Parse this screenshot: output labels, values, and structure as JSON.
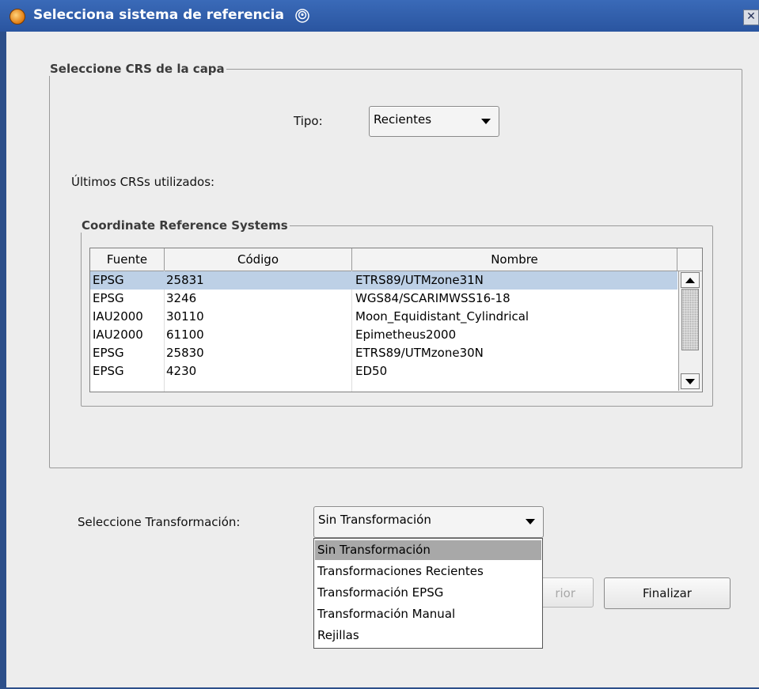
{
  "window": {
    "title": "Selecciona sistema de referencia",
    "close_glyph": "✕",
    "accent_color": "#3a6ab8"
  },
  "crs_group": {
    "legend": "Seleccione CRS de la capa",
    "tipo_label": "Tipo:",
    "tipo_value": "Recientes",
    "recent_label": "Últimos CRSs utilizados:"
  },
  "crs_table": {
    "legend": "Coordinate Reference Systems",
    "columns": [
      "Fuente",
      "Código",
      "Nombre"
    ],
    "rows": [
      {
        "fuente": "EPSG",
        "codigo": "25831",
        "nombre": "ETRS89/UTMzone31N",
        "selected": true
      },
      {
        "fuente": "EPSG",
        "codigo": "3246",
        "nombre": "WGS84/SCARIMWSS16-18",
        "selected": false
      },
      {
        "fuente": "IAU2000",
        "codigo": "30110",
        "nombre": "Moon_Equidistant_Cylindrical",
        "selected": false
      },
      {
        "fuente": "IAU2000",
        "codigo": "61100",
        "nombre": "Epimetheus2000",
        "selected": false
      },
      {
        "fuente": "EPSG",
        "codigo": "25830",
        "nombre": "ETRS89/UTMzone30N",
        "selected": false
      },
      {
        "fuente": "EPSG",
        "codigo": "4230",
        "nombre": "ED50",
        "selected": false
      }
    ]
  },
  "transformation": {
    "label": "Seleccione Transformación:",
    "value": "Sin Transformación",
    "options": [
      "Sin Transformación",
      "Transformaciones Recientes",
      "Transformación EPSG",
      "Transformación Manual",
      "Rejillas"
    ],
    "selected_index": 0
  },
  "buttons": {
    "anterior_visible": "rior",
    "finalizar": "Finalizar"
  }
}
